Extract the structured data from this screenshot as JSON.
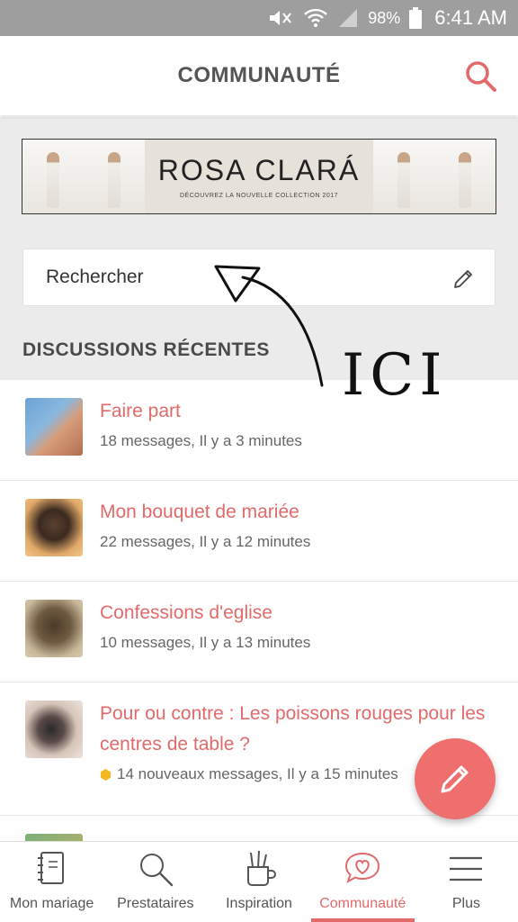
{
  "status_bar": {
    "battery_percent": "98%",
    "time": "6:41 AM",
    "icons": [
      "mute-icon",
      "wifi-icon",
      "signal-icon",
      "battery-icon"
    ]
  },
  "header": {
    "title": "COMMUNAUTÉ",
    "search_icon": "search-icon"
  },
  "banner": {
    "brand": "ROSA CLARÁ",
    "tagline": "DÉCOUVREZ LA NOUVELLE COLLECTION 2017"
  },
  "search": {
    "placeholder": "Rechercher",
    "icon": "pencil-icon"
  },
  "section": {
    "title": "DISCUSSIONS RÉCENTES"
  },
  "annotation": {
    "text": "ICI"
  },
  "discussions": [
    {
      "title": "Faire part",
      "meta": "18 messages, Il y a 3 minutes"
    },
    {
      "title": "Mon bouquet de mariée",
      "meta": "22 messages, Il y a 12 minutes"
    },
    {
      "title": "Confessions d'eglise",
      "meta": "10 messages, Il y a 13 minutes"
    },
    {
      "title": "Pour ou contre : Les poissons rouges pour les centres de table ?",
      "meta": "14 nouveaux messages, Il y a 15 minutes"
    }
  ],
  "fab": {
    "icon": "pencil-icon"
  },
  "bottom_nav": {
    "items": [
      {
        "label": "Mon mariage",
        "icon": "notebook-icon"
      },
      {
        "label": "Prestataires",
        "icon": "search-icon"
      },
      {
        "label": "Inspiration",
        "icon": "brush-cup-icon"
      },
      {
        "label": "Communauté",
        "icon": "heart-chat-icon",
        "active": true
      },
      {
        "label": "Plus",
        "icon": "menu-icon"
      }
    ]
  },
  "colors": {
    "accent": "#e26a6a",
    "fab": "#ef6f6f",
    "status_bar": "#9e9e9e",
    "section_bg": "#ebebeb"
  }
}
